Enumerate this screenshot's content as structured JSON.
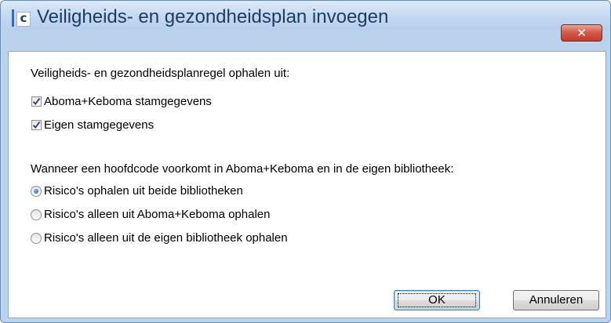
{
  "dialog": {
    "title": "Veiligheids- en gezondheidsplan invoegen",
    "app_icon_letter": "c",
    "close_label": "✕"
  },
  "section_fetch": {
    "heading": "Veiligheids- en gezondheidsplanregel ophalen uit:",
    "options": [
      {
        "label": "Aboma+Keboma stamgegevens",
        "checked": true
      },
      {
        "label": "Eigen stamgegevens",
        "checked": true
      }
    ]
  },
  "section_conflict": {
    "heading": "Wanneer een hoofdcode voorkomt in Aboma+Keboma en in de eigen bibliotheek:",
    "options": [
      {
        "label": "Risico's ophalen uit beide bibliotheken",
        "selected": true
      },
      {
        "label": "Risico's alleen uit Aboma+Keboma ophalen",
        "selected": false
      },
      {
        "label": "Risico's alleen uit de eigen bibliotheek ophalen",
        "selected": false
      }
    ]
  },
  "buttons": {
    "ok": "OK",
    "cancel": "Annuleren"
  },
  "icons": {
    "close": "close-icon",
    "app": "app-icon",
    "check": "checkmark-icon"
  },
  "colors": {
    "frame": "#bcd3ee",
    "close_button": "#c9483a",
    "accent": "#2a6ed6"
  }
}
